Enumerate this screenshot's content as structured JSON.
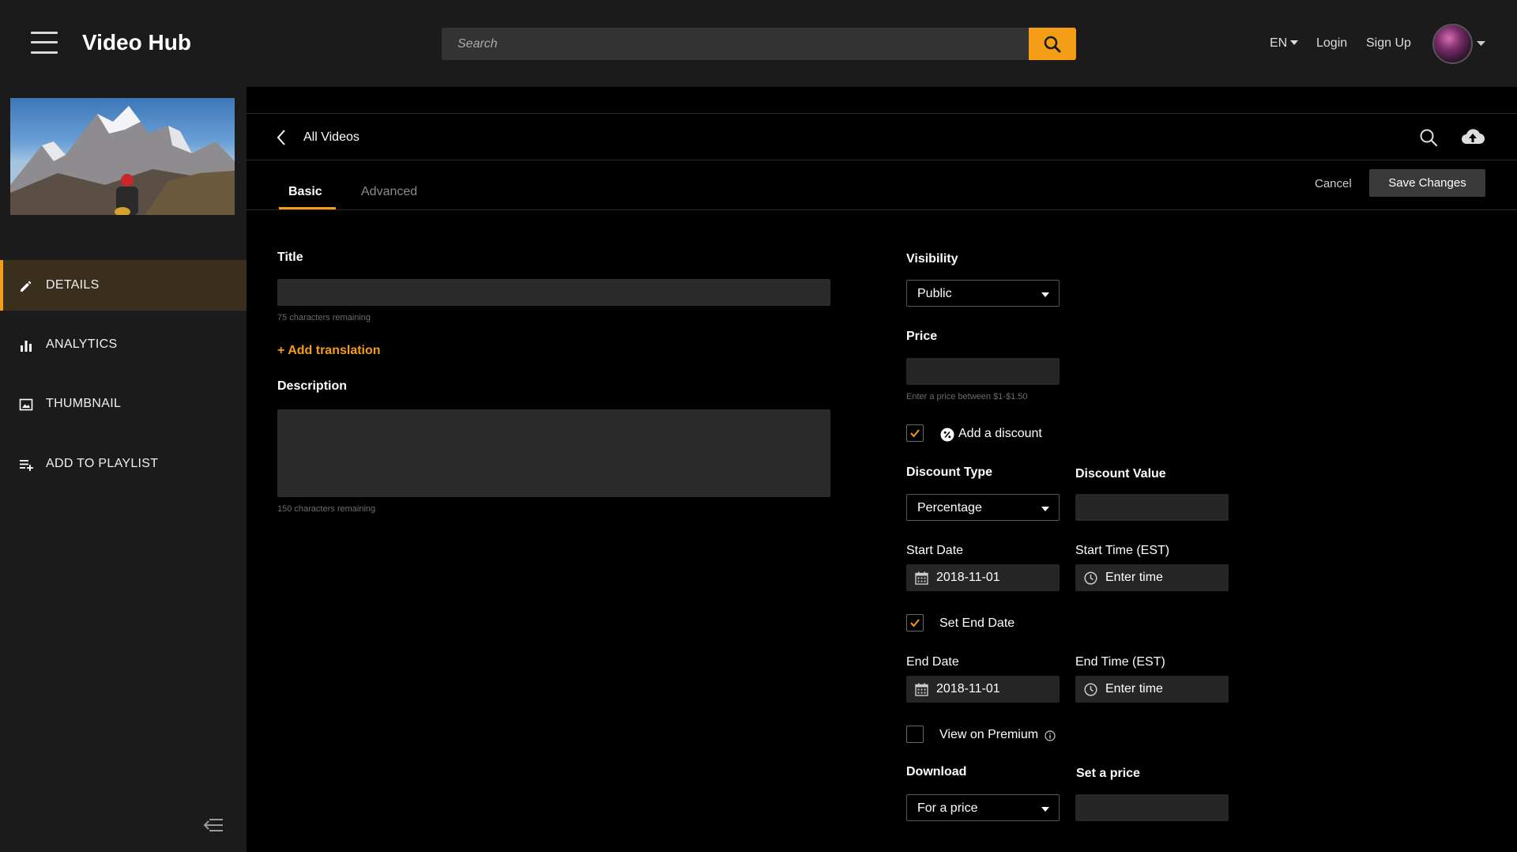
{
  "app": {
    "title": "Video Hub"
  },
  "header": {
    "search_placeholder": "Search",
    "language": "EN",
    "login": "Login",
    "signup": "Sign Up"
  },
  "sidebar": {
    "items": [
      {
        "label": "DETAILS",
        "icon": "pencil-icon",
        "active": true
      },
      {
        "label": "ANALYTICS",
        "icon": "bar-chart-icon",
        "active": false
      },
      {
        "label": "THUMBNAIL",
        "icon": "image-icon",
        "active": false
      },
      {
        "label": "ADD TO PLAYLIST",
        "icon": "playlist-add-icon",
        "active": false
      }
    ]
  },
  "breadcrumb": {
    "label": "All Videos"
  },
  "tabs": [
    {
      "label": "Basic",
      "active": true
    },
    {
      "label": "Advanced",
      "active": false
    }
  ],
  "actions": {
    "cancel": "Cancel",
    "save": "Save Changes"
  },
  "form": {
    "title": {
      "label": "Title",
      "value": "",
      "hint": "75 characters remaining"
    },
    "add_translation": "+ Add translation",
    "description": {
      "label": "Description",
      "value": "",
      "hint": "150 characters remaining"
    },
    "visibility": {
      "label": "Visibility",
      "value": "Public"
    },
    "price": {
      "label": "Price",
      "value": "",
      "hint": "Enter a price between $1-$1.50"
    },
    "add_discount": {
      "label": "Add a discount",
      "checked": true
    },
    "discount_type": {
      "label": "Discount Type",
      "value": "Percentage"
    },
    "discount_value": {
      "label": "Discount Value",
      "value": ""
    },
    "start_date": {
      "label": "Start Date",
      "value": "2018-11-01"
    },
    "start_time": {
      "label": "Start Time (EST)",
      "value": "Enter time"
    },
    "set_end_date": {
      "label": "Set End Date",
      "checked": true
    },
    "end_date": {
      "label": "End Date",
      "value": "2018-11-01"
    },
    "end_time": {
      "label": "End Time (EST)",
      "value": "Enter time"
    },
    "view_on_premium": {
      "label": "View on Premium",
      "checked": false
    },
    "download": {
      "label": "Download",
      "value": "For a price"
    },
    "set_a_price": {
      "label": "Set a price",
      "value": ""
    }
  },
  "colors": {
    "accent": "#f59d16",
    "background": "#000000",
    "panel": "#1b1b1b"
  }
}
